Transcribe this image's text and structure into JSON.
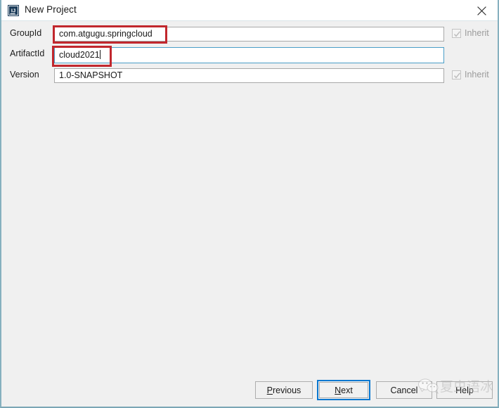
{
  "window": {
    "title": "New Project",
    "app_icon": "intellij-idea-icon",
    "close_icon": "close-icon",
    "accent_border_color": "#86b0bf",
    "background_color": "#f0f0f0"
  },
  "form": {
    "fields": [
      {
        "label": "GroupId",
        "value": "com.atgugu.springcloud",
        "placeholder": "",
        "focused": false,
        "inherit": {
          "label": "Inherit",
          "checked": true,
          "disabled": true
        }
      },
      {
        "label": "ArtifactId",
        "value": "cloud2021",
        "placeholder": "",
        "focused": true,
        "inherit": null
      },
      {
        "label": "Version",
        "value": "1.0-SNAPSHOT",
        "placeholder": "",
        "focused": false,
        "inherit": {
          "label": "Inherit",
          "checked": true,
          "disabled": true
        }
      }
    ]
  },
  "annotations": {
    "color": "#c1272d",
    "boxes": [
      {
        "target": "groupid-input-value"
      },
      {
        "target": "artifactid-input-value"
      }
    ]
  },
  "footer": {
    "buttons": [
      {
        "name": "previous",
        "label": "Previous",
        "mnemonic": "P",
        "default": false
      },
      {
        "name": "next",
        "label": "Next",
        "mnemonic": "N",
        "default": true
      },
      {
        "name": "cancel",
        "label": "Cancel",
        "mnemonic": "",
        "default": false
      },
      {
        "name": "help",
        "label": "Help",
        "mnemonic": "",
        "default": false
      }
    ],
    "default_button_border_color": "#0b78d0"
  },
  "watermark": {
    "text": "夏虫语冰",
    "logo": "wechat-icon",
    "color": "#b6b6b6"
  }
}
